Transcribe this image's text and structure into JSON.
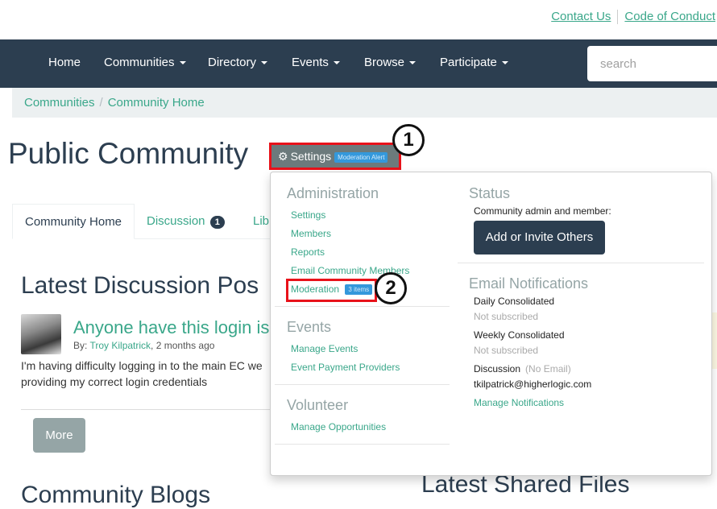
{
  "util_links": {
    "contact": "Contact Us",
    "code": "Code of Conduct"
  },
  "nav": {
    "items": [
      "Home",
      "Communities",
      "Directory",
      "Events",
      "Browse",
      "Participate"
    ],
    "search_placeholder": "search"
  },
  "breadcrumb": [
    "Communities",
    "Community Home"
  ],
  "page_title": "Public Community",
  "settings": {
    "label": "Settings",
    "badge": "Moderation Alert"
  },
  "callouts": [
    "1",
    "2"
  ],
  "tabs": {
    "home": "Community Home",
    "discussion": "Discussion",
    "discussion_count": "1",
    "library": "Lib"
  },
  "latest": {
    "heading": "Latest Discussion Pos",
    "post_title": "Anyone have this login is",
    "by_label": "By:",
    "author": "Troy Kilpatrick",
    "time": ", 2 months ago",
    "body_line1": "I'm having difficulty logging in to the main EC we",
    "body_line2": "providing my correct login credentials",
    "more": "More"
  },
  "blogs_heading": "Community Blogs",
  "files_heading": "Latest Shared Files",
  "dropdown": {
    "admin_heading": "Administration",
    "admin_links": [
      "Settings",
      "Members",
      "Reports",
      "Email Community Members"
    ],
    "moderation": "Moderation",
    "moderation_badge": "3 items",
    "events_heading": "Events",
    "events_links": [
      "Manage Events",
      "Event Payment Providers"
    ],
    "volunteer_heading": "Volunteer",
    "volunteer_links": [
      "Manage Opportunities"
    ],
    "status_heading": "Status",
    "status_text": "Community admin and member:",
    "add_button": "Add or Invite Others",
    "email_heading": "Email Notifications",
    "daily": "Daily Consolidated",
    "daily_status": "Not subscribed",
    "weekly": "Weekly Consolidated",
    "weekly_status": "Not subscribed",
    "discussion": "Discussion",
    "discussion_status": "(No Email)",
    "email": "tkilpatrick@higherlogic.com",
    "manage": "Manage Notifications"
  }
}
